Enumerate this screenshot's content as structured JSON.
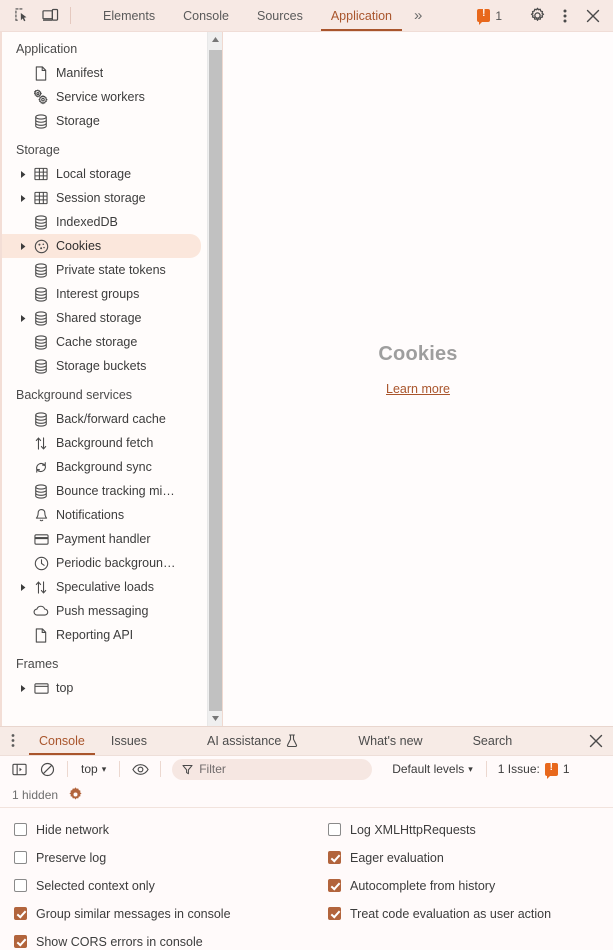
{
  "topbar": {
    "inspect_icon": "inspect-element-icon",
    "device_icon": "device-toolbar-icon",
    "tabs": [
      {
        "label": "Elements",
        "selected": false
      },
      {
        "label": "Console",
        "selected": false
      },
      {
        "label": "Sources",
        "selected": false
      },
      {
        "label": "Application",
        "selected": true
      }
    ],
    "more_tabs_label": "»",
    "issue_count": "1",
    "settings_icon": "gear-icon",
    "more_options_icon": "kebab-menu-icon",
    "close_icon": "close-icon"
  },
  "sidebar": {
    "sections": [
      {
        "title": "Application",
        "items": [
          {
            "label": "Manifest",
            "icon": "document-icon",
            "twisty": false,
            "selected": false
          },
          {
            "label": "Service workers",
            "icon": "gears-icon",
            "twisty": false,
            "selected": false
          },
          {
            "label": "Storage",
            "icon": "database-icon",
            "twisty": false,
            "selected": false
          }
        ]
      },
      {
        "title": "Storage",
        "items": [
          {
            "label": "Local storage",
            "icon": "table-icon",
            "twisty": true,
            "selected": false
          },
          {
            "label": "Session storage",
            "icon": "table-icon",
            "twisty": true,
            "selected": false
          },
          {
            "label": "IndexedDB",
            "icon": "database-icon",
            "twisty": false,
            "selected": false
          },
          {
            "label": "Cookies",
            "icon": "cookie-icon",
            "twisty": true,
            "selected": true
          },
          {
            "label": "Private state tokens",
            "icon": "database-icon",
            "twisty": false,
            "selected": false
          },
          {
            "label": "Interest groups",
            "icon": "database-icon",
            "twisty": false,
            "selected": false
          },
          {
            "label": "Shared storage",
            "icon": "database-icon",
            "twisty": true,
            "selected": false
          },
          {
            "label": "Cache storage",
            "icon": "database-icon",
            "twisty": false,
            "selected": false
          },
          {
            "label": "Storage buckets",
            "icon": "database-icon",
            "twisty": false,
            "selected": false
          }
        ]
      },
      {
        "title": "Background services",
        "items": [
          {
            "label": "Back/forward cache",
            "icon": "database-icon",
            "twisty": false,
            "selected": false
          },
          {
            "label": "Background fetch",
            "icon": "up-down-arrows-icon",
            "twisty": false,
            "selected": false
          },
          {
            "label": "Background sync",
            "icon": "sync-icon",
            "twisty": false,
            "selected": false
          },
          {
            "label": "Bounce tracking mi…",
            "icon": "database-icon",
            "twisty": false,
            "selected": false
          },
          {
            "label": "Notifications",
            "icon": "bell-icon",
            "twisty": false,
            "selected": false
          },
          {
            "label": "Payment handler",
            "icon": "credit-card-icon",
            "twisty": false,
            "selected": false
          },
          {
            "label": "Periodic backgroun…",
            "icon": "clock-icon",
            "twisty": false,
            "selected": false
          },
          {
            "label": "Speculative loads",
            "icon": "up-down-arrows-icon",
            "twisty": true,
            "selected": false
          },
          {
            "label": "Push messaging",
            "icon": "cloud-icon",
            "twisty": false,
            "selected": false
          },
          {
            "label": "Reporting API",
            "icon": "document-icon",
            "twisty": false,
            "selected": false
          }
        ]
      },
      {
        "title": "Frames",
        "items": [
          {
            "label": "top",
            "icon": "frame-icon",
            "twisty": true,
            "selected": false
          }
        ]
      }
    ]
  },
  "content": {
    "empty_title": "Cookies",
    "learn_more_label": "Learn more"
  },
  "drawer": {
    "menu_icon": "kebab-menu-icon",
    "tabs": [
      {
        "label": "Console",
        "selected": true,
        "icon": null
      },
      {
        "label": "Issues",
        "selected": false,
        "icon": null
      },
      {
        "label": "AI assistance",
        "selected": false,
        "icon": "experiment-flask-icon"
      },
      {
        "label": "What's new",
        "selected": false,
        "icon": null
      },
      {
        "label": "Search",
        "selected": false,
        "icon": null
      }
    ],
    "close_icon": "close-icon",
    "toolbar": {
      "sidebar_toggle_icon": "console-sidebar-icon",
      "clear_icon": "clear-console-icon",
      "context_value": "top",
      "context_caret": "▾",
      "eye_icon": "live-expression-eye-icon",
      "filter_icon": "filter-funnel-icon",
      "filter_placeholder": "Filter",
      "filter_value": "",
      "levels_label": "Default levels",
      "levels_caret": "▾",
      "issues_label": "1 Issue:",
      "issues_count": "1"
    },
    "hidden_row": {
      "label": "1 hidden",
      "gear_icon": "settings-gear-icon"
    },
    "settings": [
      {
        "label": "Hide network",
        "checked": false
      },
      {
        "label": "Log XMLHttpRequests",
        "checked": false
      },
      {
        "label": "Preserve log",
        "checked": false
      },
      {
        "label": "Eager evaluation",
        "checked": true
      },
      {
        "label": "Selected context only",
        "checked": false
      },
      {
        "label": "Autocomplete from history",
        "checked": true
      },
      {
        "label": "Group similar messages in console",
        "checked": true
      },
      {
        "label": "Treat code evaluation as user action",
        "checked": true
      },
      {
        "label": "Show CORS errors in console",
        "checked": true
      }
    ]
  },
  "colors": {
    "accent": "#a9552c",
    "selection_bg": "#fbe7dc",
    "topbar_bg": "#f7e9e4",
    "issue_orange": "#e8681c",
    "checkbox_checked": "#b2643c"
  }
}
